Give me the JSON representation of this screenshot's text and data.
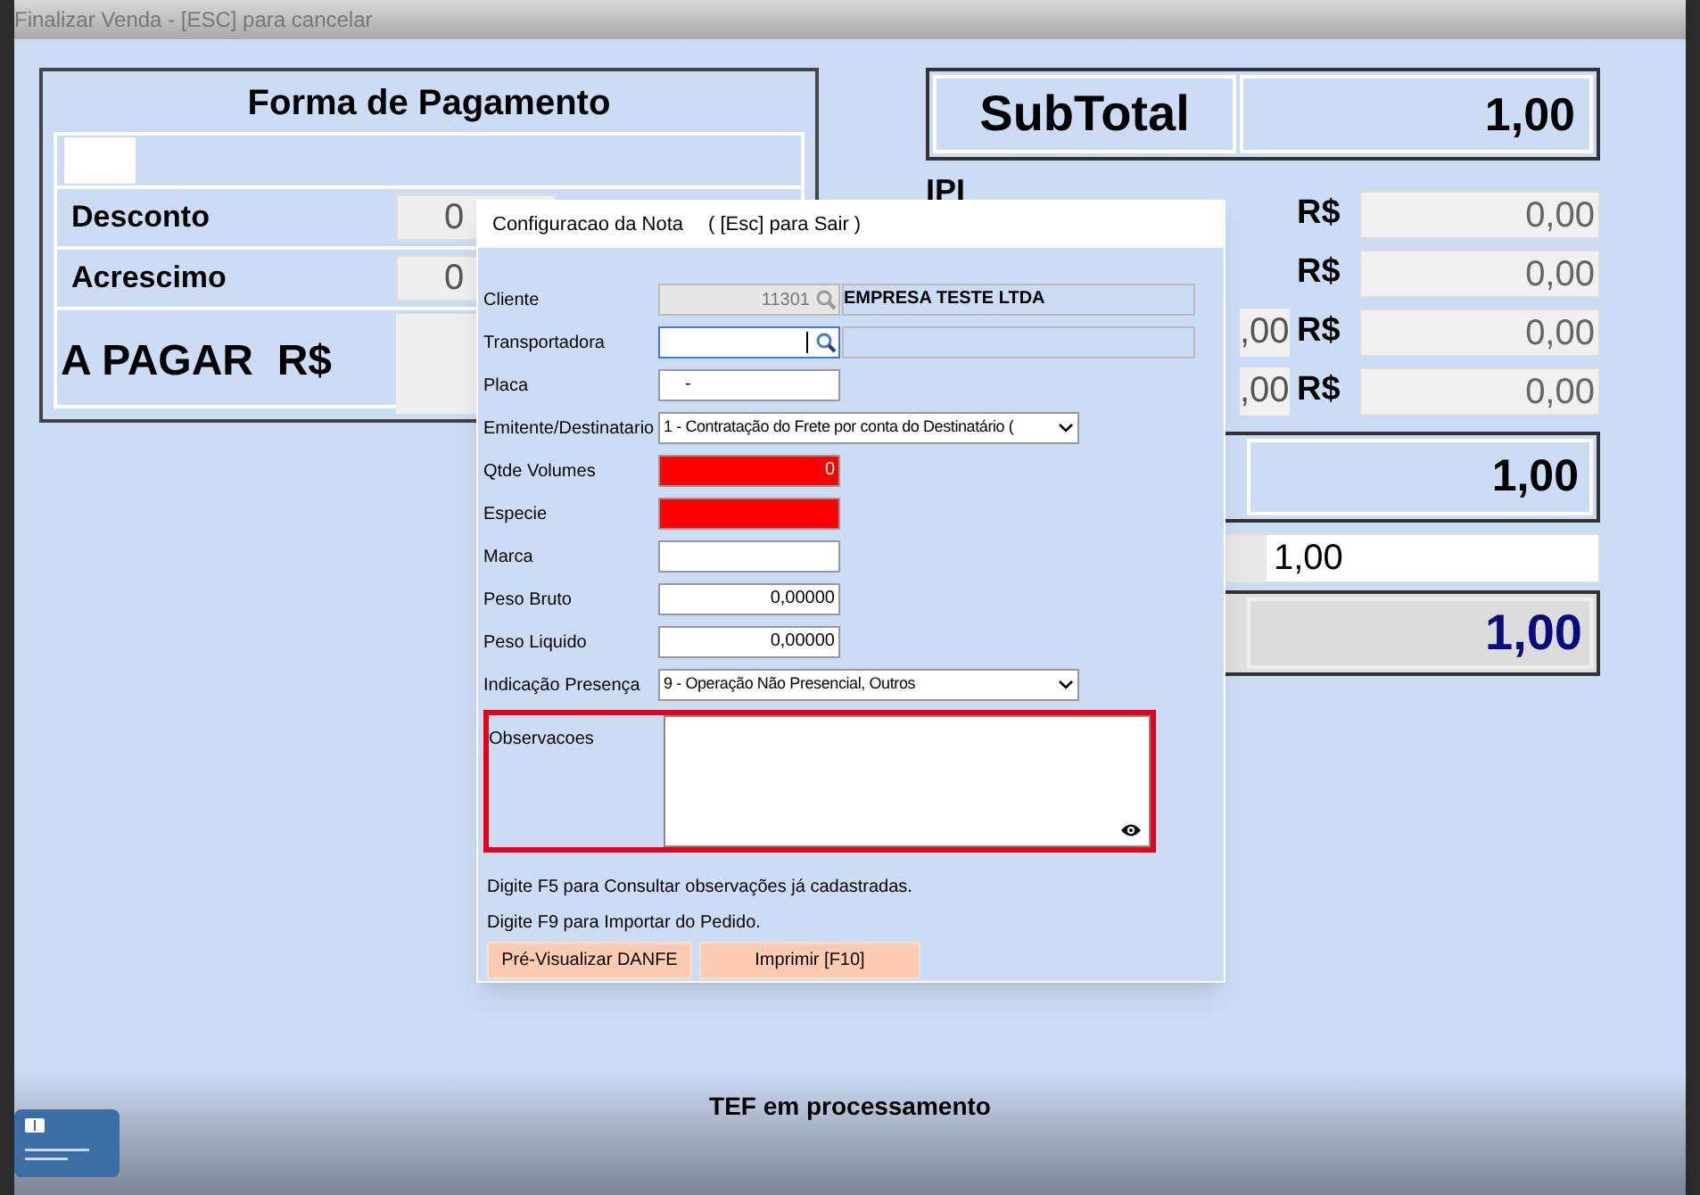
{
  "window": {
    "title": "Finalizar Venda - [ESC] para cancelar"
  },
  "payment_panel": {
    "title": "Forma de Pagamento",
    "rows": [
      {
        "label": "Desconto",
        "value": "0"
      },
      {
        "label": "Acrescimo",
        "value": "0"
      }
    ],
    "total_label": "A PAGAR  R$"
  },
  "totals": {
    "subtotal_label": "SubTotal",
    "subtotal_value": "1,00",
    "tax_label": "IPI",
    "tax_rows": [
      {
        "currency": "R$",
        "value": "0,00"
      },
      {
        "currency": "R$",
        "value": "0,00"
      },
      {
        "partial_value": ",00",
        "currency": "R$",
        "value": "0,00"
      },
      {
        "partial_value": ",00",
        "currency": "R$",
        "value": "0,00"
      }
    ],
    "total_value": "1,00",
    "received_value": "1,00",
    "due_value": "1,00"
  },
  "dialog": {
    "title": "Configuracao da Nota",
    "hint": "( [Esc] para Sair )",
    "fields": [
      {
        "kind": "lookup",
        "label": "Cliente",
        "value": "11301",
        "name": "EMPRESA TESTE LTDA",
        "disabled": true,
        "focused": false
      },
      {
        "kind": "lookup",
        "label": "Transportadora",
        "disabled": false,
        "focused": true
      },
      {
        "kind": "text",
        "label": "Placa",
        "value": "-",
        "error": false
      },
      {
        "kind": "select",
        "label": "Emitente/Destinatario",
        "value": "1 - Contratação do Frete por conta do Destinatário ("
      },
      {
        "kind": "number",
        "label": "Qtde Volumes",
        "value": "0",
        "error": true
      },
      {
        "kind": "text",
        "label": "Especie",
        "error": true
      },
      {
        "kind": "text",
        "label": "Marca",
        "error": false
      },
      {
        "kind": "number",
        "label": "Peso Bruto",
        "value": "0,00000",
        "error": false
      },
      {
        "kind": "number",
        "label": "Peso Liquido",
        "value": "0,00000",
        "error": false
      },
      {
        "kind": "select",
        "label": "Indicação Presença",
        "value": "9 - Operação Não Presencial, Outros"
      },
      {
        "kind": "memo",
        "label": "Observacoes",
        "highlighted": true
      }
    ],
    "notes": [
      "Digite F5 para Consultar observações já cadastradas.",
      "Digite F9 para Importar do Pedido."
    ],
    "buttons": [
      "Pré-Visualizar DANFE",
      "Imprimir [F10]"
    ]
  },
  "status": "TEF em processamento"
}
